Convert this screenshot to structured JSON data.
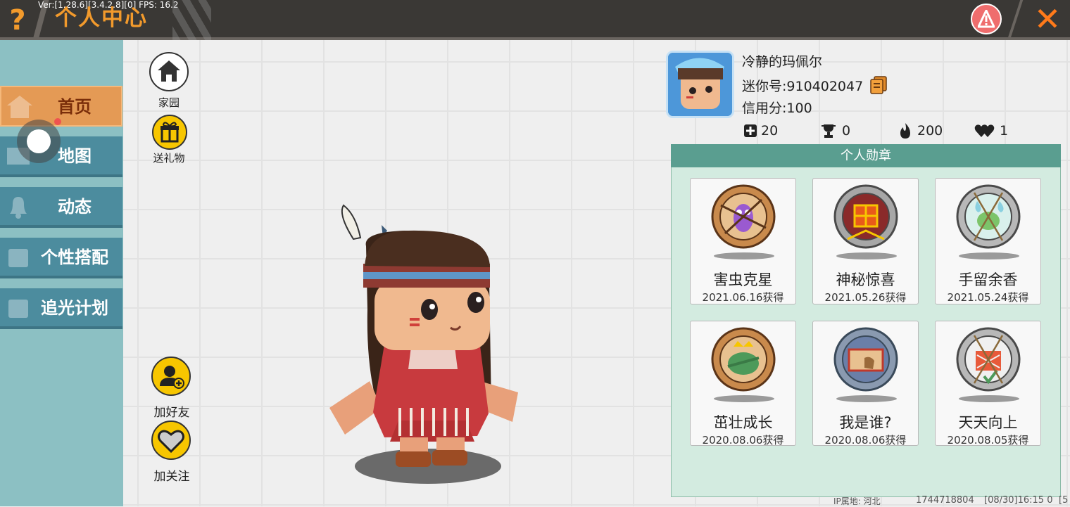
{
  "header": {
    "help_icon": "question-mark-icon",
    "version": "Ver:[1.28.6][3.4.2.8][0] FPS: 16.2",
    "title": "个人中心",
    "report_icon": "warning-icon",
    "close_icon": "close-x-icon"
  },
  "sidebar": {
    "items": [
      {
        "label": "首页",
        "icon": "house-icon",
        "active": true
      },
      {
        "label": "地图",
        "icon": "map-icon"
      },
      {
        "label": "动态",
        "icon": "bell-icon"
      },
      {
        "label": "个性搭配",
        "icon": "outfit-icon"
      },
      {
        "label": "追光计划",
        "icon": "plan-icon"
      }
    ]
  },
  "actions": {
    "home": "家园",
    "gift": "送礼物",
    "add_friend": "加好友",
    "follow": "加关注"
  },
  "profile": {
    "nickname": "冷静的玛佩尔",
    "mini_id": "迷你号:910402047",
    "credit": "信用分:100",
    "stats": [
      {
        "icon": "plus-icon",
        "value": "20"
      },
      {
        "icon": "trophy-icon",
        "value": "0"
      },
      {
        "icon": "flame-icon",
        "value": "200"
      },
      {
        "icon": "hearts-icon",
        "value": "1"
      }
    ]
  },
  "badges": {
    "title": "个人勋章",
    "items": [
      {
        "name": "害虫克星",
        "date": "2021.06.16获得",
        "icon": "pest-buster-medal-icon"
      },
      {
        "name": "神秘惊喜",
        "date": "2021.05.26获得",
        "icon": "mystery-surprise-medal-icon"
      },
      {
        "name": "手留余香",
        "date": "2021.05.24获得",
        "icon": "fragrance-medal-icon"
      },
      {
        "name": "茁壮成长",
        "date": "2020.08.06获得",
        "icon": "growing-medal-icon"
      },
      {
        "name": "我是谁?",
        "date": "2020.08.06获得",
        "icon": "who-am-i-medal-icon"
      },
      {
        "name": "天天向上",
        "date": "2020.08.05获得",
        "icon": "daily-progress-medal-icon"
      }
    ]
  },
  "footer": {
    "ip": "IP属地: 河北",
    "id": "1744718804",
    "time": "[08/30]16:15 0",
    "extra": "[5"
  },
  "colors": {
    "accent_orange": "#f29a2c",
    "sidebar_tab": "#4c8c9e",
    "panel_head": "#5a9e90"
  }
}
